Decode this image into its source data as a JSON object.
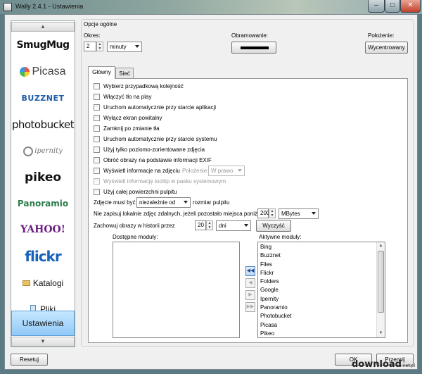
{
  "window": {
    "title": "Wally 2.4.1 - Ustawienia",
    "min": "–",
    "max": "□",
    "close": "✕"
  },
  "sidebar": {
    "scroll_up": "▲",
    "scroll_down": "▼",
    "items": [
      {
        "label": "SmugMug"
      },
      {
        "label": "Picasa"
      },
      {
        "label": "BUZZNET"
      },
      {
        "label": "photobucket"
      },
      {
        "label": "ipernity"
      },
      {
        "label": "pikeo"
      },
      {
        "label": "Panoramio"
      },
      {
        "label": "YAHOO!"
      },
      {
        "label": "flickr"
      },
      {
        "label": "Katalogi"
      },
      {
        "label": "Pliki"
      },
      {
        "label": "Ustawienia"
      }
    ]
  },
  "general": {
    "group_title": "Opcje ogólne",
    "period_label": "Okres:",
    "period_value": "2",
    "period_unit": "minuty",
    "border_label": "Obramowanie:",
    "position_label": "Położenie:",
    "position_value": "Wycentrowany"
  },
  "tabs": [
    {
      "label": "Główny",
      "active": true
    },
    {
      "label": "Sieć",
      "active": false
    }
  ],
  "options": [
    {
      "label": "Wybierz przypadkową kolejność",
      "enabled": true
    },
    {
      "label": "Włączyć tło na play",
      "enabled": true
    },
    {
      "label": "Uruchom automatycznie przy starcie aplikacji",
      "enabled": true
    },
    {
      "label": "Wyłącz ekran powitalny",
      "enabled": true
    },
    {
      "label": "Zamknij po zmianie tła",
      "enabled": true
    },
    {
      "label": "Uruchom automatycznie przy starcie systemu",
      "enabled": true
    },
    {
      "label": "Użyj tylko poziomo-zorientowane zdjęcia",
      "enabled": true
    },
    {
      "label": "Obróć obrazy na podstawie informacji EXIF",
      "enabled": true
    },
    {
      "label": "Wyświetl informacje na zdjęciu",
      "enabled": true
    },
    {
      "label": "Wyświetl informację tooltip w pasku systemowym",
      "enabled": false
    },
    {
      "label": "Użyj całej powierzchni pulpitu",
      "enabled": true
    }
  ],
  "info_position": {
    "label": "Położenie:",
    "value": "W prawo"
  },
  "size_row": {
    "prefix": "Zdjęcie musi być",
    "value": "niezależnie od",
    "suffix": "rozmiar pulpitu"
  },
  "space_row": {
    "label": "Nie zapisuj lokalnie zdjęc zdalnych, jeżeli pozostało miejsca poniżej",
    "value": "200",
    "unit": "MBytes"
  },
  "history_row": {
    "label": "Zachowuj obrazy w historii przez",
    "value": "20",
    "unit": "dni",
    "clear": "Wyczyść"
  },
  "modules": {
    "available_label": "Dostępne moduły:",
    "active_label": "Aktywne moduły:",
    "active": [
      "Bing",
      "Buzznet",
      "Files",
      "Flickr",
      "Folders",
      "Google",
      "Ipernity",
      "Panoramio",
      "Photobucket",
      "Picasa",
      "Pikeo"
    ]
  },
  "buttons": {
    "reset": "Resetuj",
    "ok": "OK",
    "cancel": "Przerwij"
  },
  "watermark": {
    "text": "download",
    "suffix": ".net.pl"
  }
}
